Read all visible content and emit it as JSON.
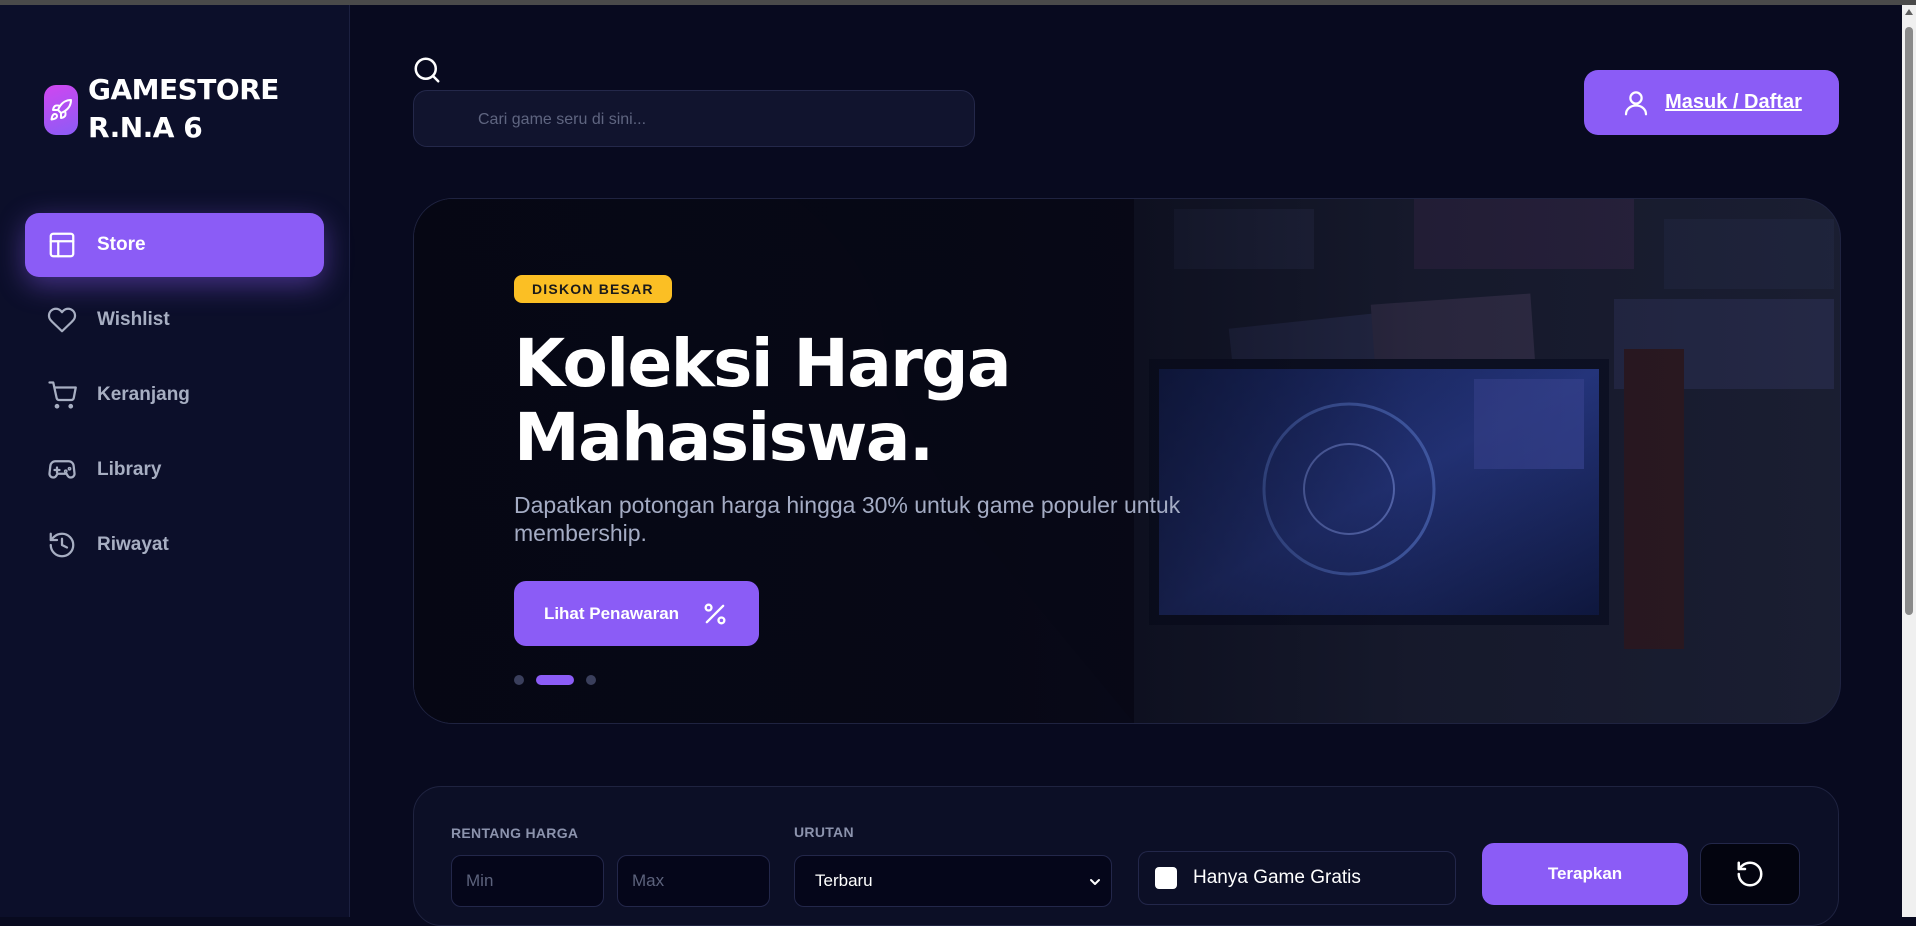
{
  "brand": {
    "line1": "GAMESTORE",
    "line2": "R.N.A 6",
    "icon": "rocket-icon",
    "accent": "#8b5cf6"
  },
  "nav": {
    "items": [
      {
        "label": "Store",
        "icon": "store-icon",
        "active": true
      },
      {
        "label": "Wishlist",
        "icon": "heart-icon",
        "active": false
      },
      {
        "label": "Keranjang",
        "icon": "cart-icon",
        "active": false
      },
      {
        "label": "Library",
        "icon": "gamepad-icon",
        "active": false
      },
      {
        "label": "Riwayat",
        "icon": "history-icon",
        "active": false
      }
    ]
  },
  "search": {
    "placeholder": "Cari game seru di sini..."
  },
  "header": {
    "login_label": "Masuk / Daftar"
  },
  "hero": {
    "badge": "DISKON BESAR",
    "title_line1": "Koleksi Harga",
    "title_line2": "Mahasiswa.",
    "subtitle": "Dapatkan potongan harga hingga 30% untuk game populer untuk membership.",
    "cta_label": "Lihat Penawaran",
    "slide_count": 3,
    "active_slide": 2
  },
  "filters": {
    "price_label": "RENTANG HARGA",
    "min_placeholder": "Min",
    "max_placeholder": "Max",
    "sort_label": "URUTAN",
    "sort_value": "Terbaru",
    "free_only_label": "Hanya Game Gratis",
    "free_only_checked": false,
    "apply_label": "Terapkan"
  },
  "colors": {
    "accent": "#8b5cf6",
    "badge": "#fbbf24",
    "background": "#080a1f"
  }
}
